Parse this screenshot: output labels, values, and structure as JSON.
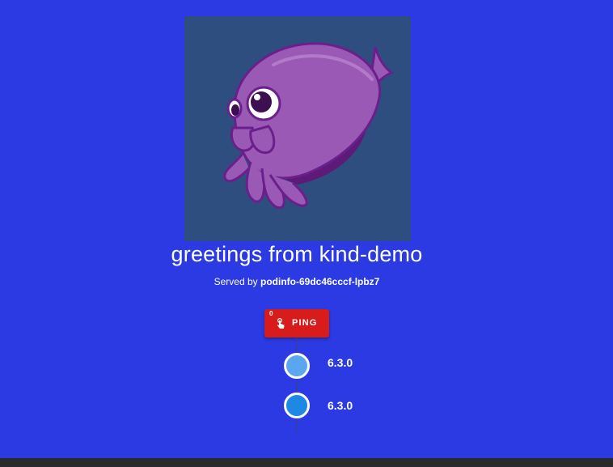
{
  "header": {
    "greeting": "greetings from kind-demo",
    "served_by_prefix": "Served by",
    "hostname": "podinfo-69dc46cccf-lpbz7"
  },
  "ping": {
    "label": "PING",
    "count": "0",
    "color": "#d81b1b",
    "icon": "touch-app-icon"
  },
  "versions": [
    {
      "version": "6.3.0",
      "color": "#5aa7f0"
    },
    {
      "version": "6.3.0",
      "color": "#1e88e5"
    }
  ],
  "theme": {
    "background": "#2b3ae3",
    "logo_background": "#2f4e80",
    "mascot_color": "#9b59b6"
  },
  "logo": {
    "icon": "cuttlefish-mascot-icon"
  }
}
